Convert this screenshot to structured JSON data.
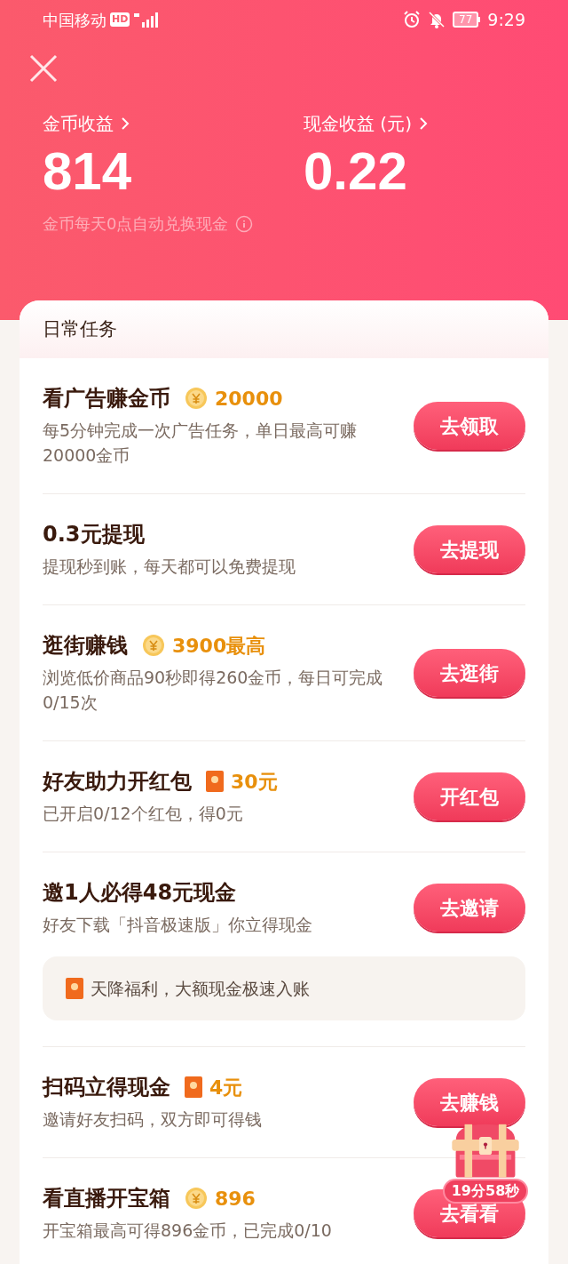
{
  "status_bar": {
    "carrier": "中国移动",
    "hd": "HD",
    "battery": "77",
    "time": "9:29"
  },
  "earnings": [
    {
      "label": "金币收益",
      "value": "814"
    },
    {
      "label": "现金收益 (元)",
      "value": "0.22"
    }
  ],
  "note": "金币每天0点自动兑换现金",
  "section_title": "日常任务",
  "tasks": [
    {
      "title": "看广告赚金币",
      "kind": "coin",
      "reward": "20000",
      "description": "每5分钟完成一次广告任务，单日最高可赚20000金币",
      "button": "去领取"
    },
    {
      "title": "0.3元提现",
      "description": "提现秒到账，每天都可以免费提现",
      "button": "去提现"
    },
    {
      "title": "逛街赚钱",
      "kind": "coin",
      "reward": "3900最高",
      "description": "浏览低价商品90秒即得260金币，每日可完成0/15次",
      "button": "去逛街"
    },
    {
      "title": "好友助力开红包",
      "kind": "envelope",
      "reward": "30元",
      "description": "已开启0/12个红包，得0元",
      "button": "开红包"
    },
    {
      "title": "邀1人必得48元现金",
      "description": "好友下载「抖音极速版」你立得现金",
      "button": "去邀请",
      "notice": "天降福利，大额现金极速入账"
    },
    {
      "title": "扫码立得现金",
      "kind": "envelope",
      "reward": "4元",
      "description": "邀请好友扫码，双方即可得钱",
      "button": "去赚钱"
    },
    {
      "title": "看直播开宝箱",
      "kind": "coin",
      "reward": "896",
      "description": "开宝箱最高可得896金币，已完成0/10",
      "button": "去看看"
    }
  ],
  "chest": {
    "timer": "19分58秒"
  }
}
